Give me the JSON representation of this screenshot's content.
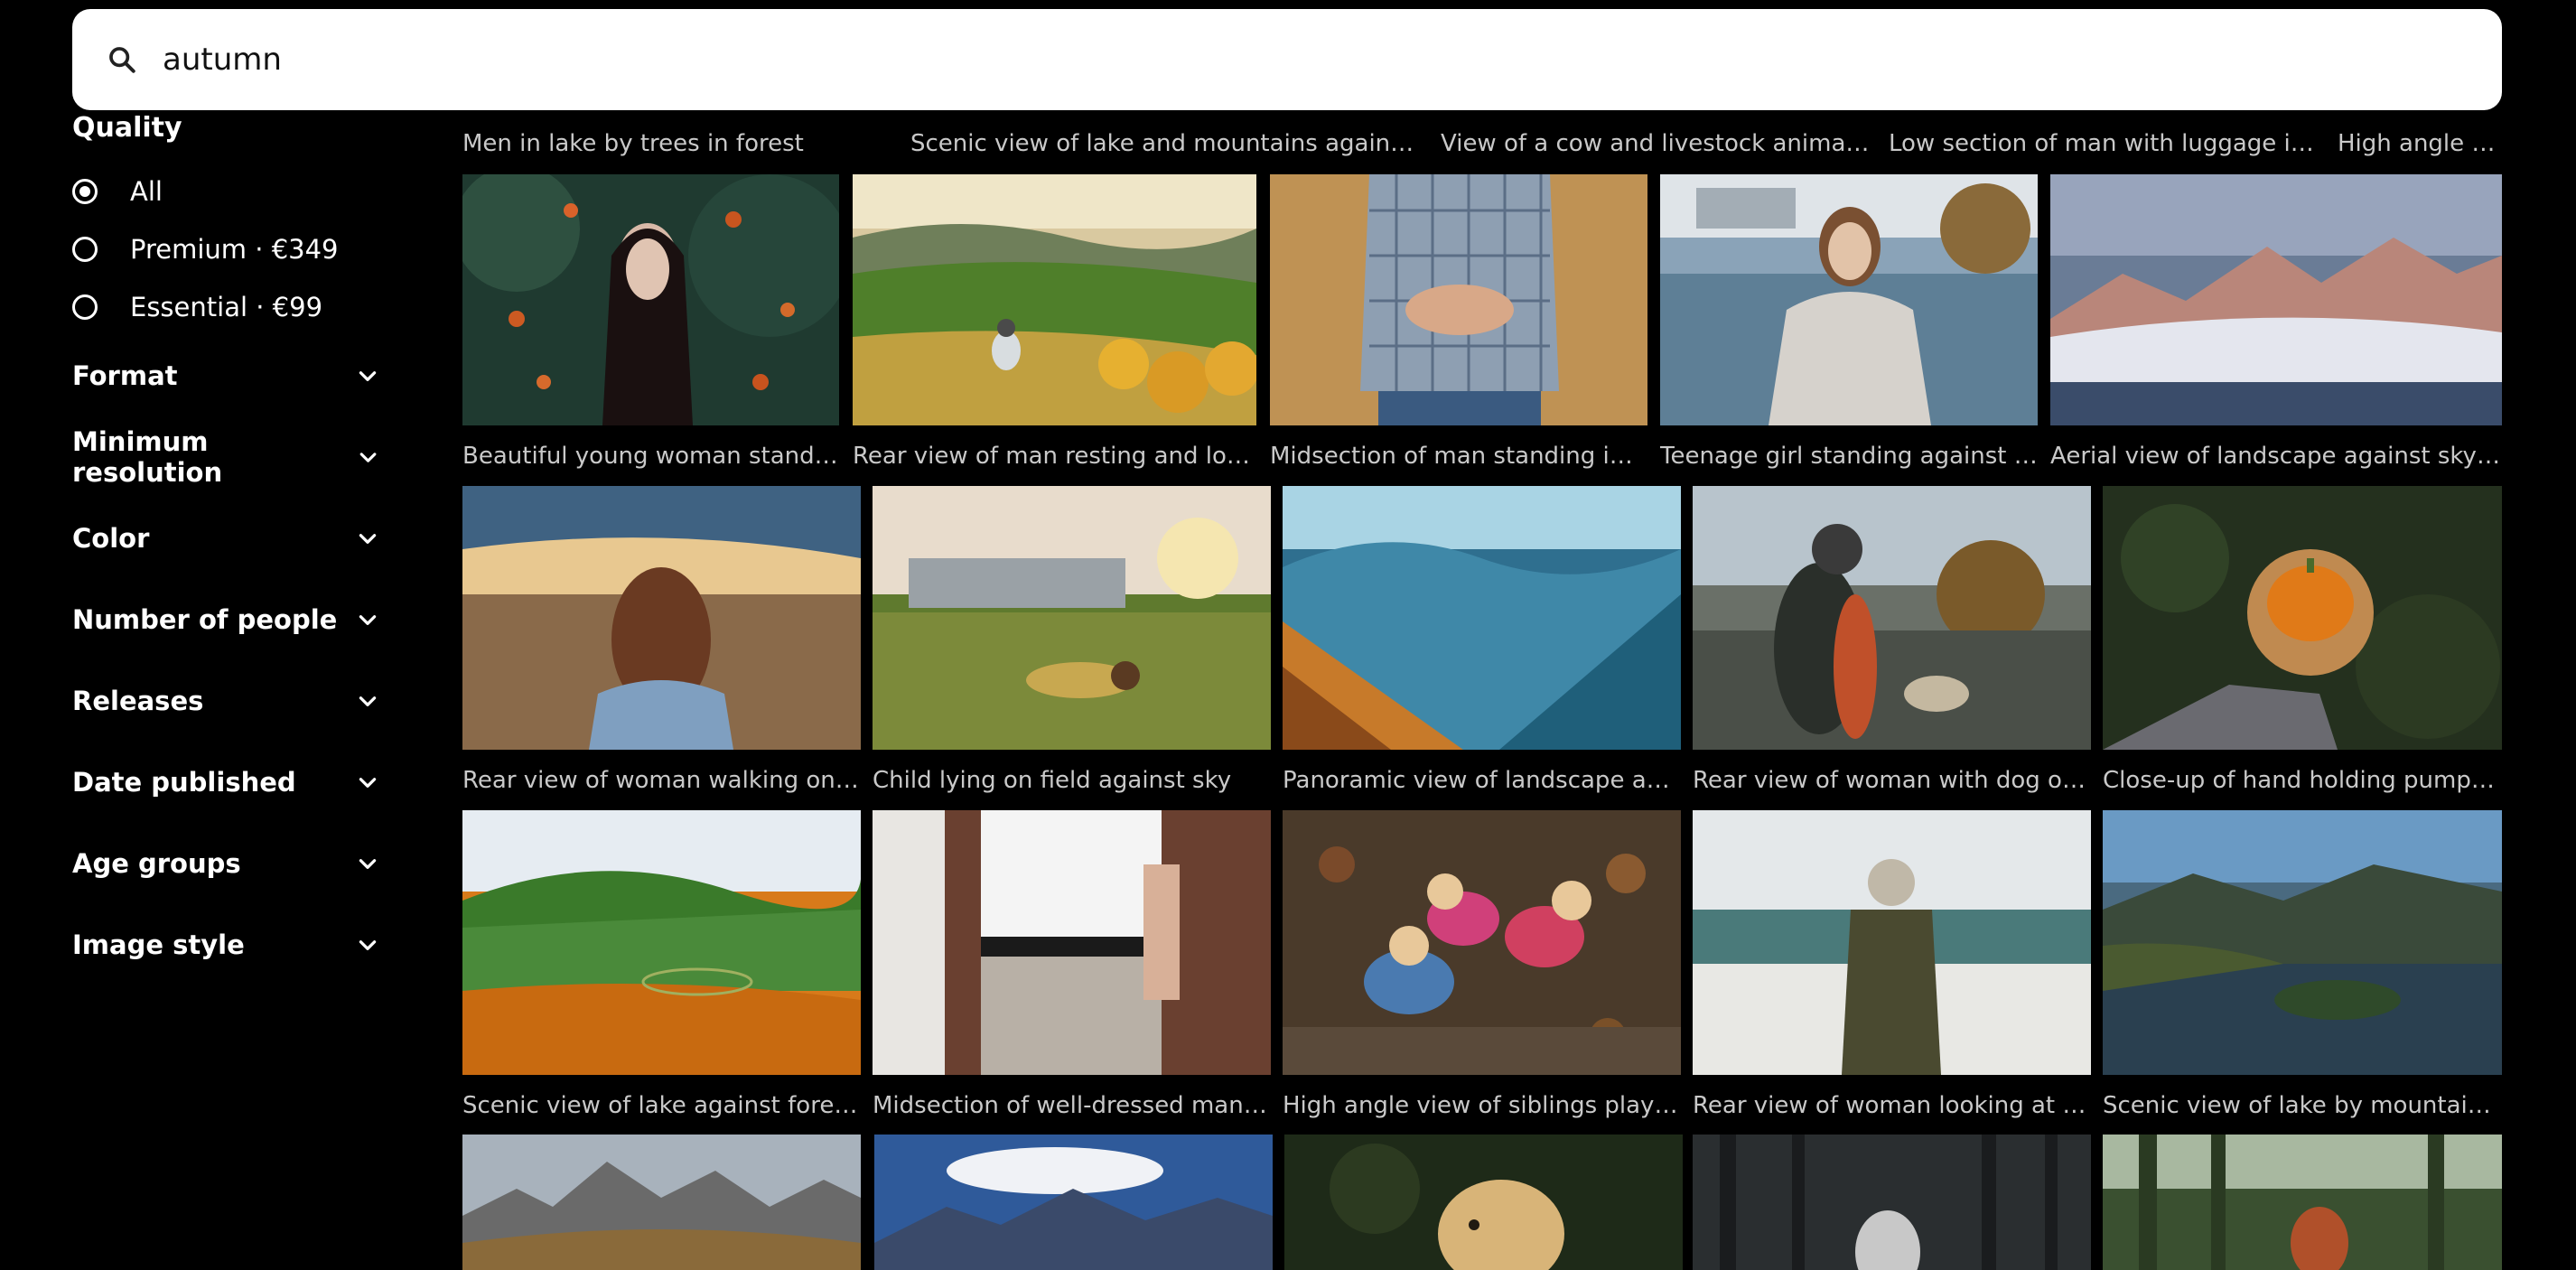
{
  "search": {
    "value": "autumn",
    "placeholder": ""
  },
  "sidebar": {
    "quality_title": "Quality",
    "quality_options": [
      {
        "label": "All",
        "selected": true
      },
      {
        "label": "Premium · €349",
        "selected": false
      },
      {
        "label": "Essential · €99",
        "selected": false
      }
    ],
    "filters": [
      "Format",
      "Minimum resolution",
      "Color",
      "Number of people",
      "Releases",
      "Date published",
      "Age groups",
      "Image style"
    ]
  },
  "rows": [
    {
      "captions": [
        "Men in lake by trees in forest",
        "Scenic view of lake and mountains against sky",
        "View of a cow and livestock animals on fi...",
        "Low section of man with luggage in fores...",
        "High angle vie..."
      ]
    },
    {
      "captions": [
        "Beautiful young woman standing a...",
        "Rear view of man resting and looking ...",
        "Midsection of man standing in land",
        "Teenage girl standing against river",
        "Aerial view of landscape against sky durin..."
      ]
    },
    {
      "captions": [
        "Rear view of woman walking on field ...",
        "Child lying on field against sky",
        "Panoramic view of landscape and mo...",
        "Rear view of woman with dog on field",
        "Close-up of hand holding pumpkin"
      ]
    },
    {
      "captions": [
        "Scenic view of lake against forest an...",
        "Midsection of well-dressed man stan...",
        "High angle view of siblings playing w...",
        "Rear view of woman looking at sea",
        "Scenic view of lake by mountains aga..."
      ]
    }
  ],
  "colors": {
    "background": "#000000",
    "caption": "#c9c9c9",
    "search_bg": "#ffffff"
  }
}
